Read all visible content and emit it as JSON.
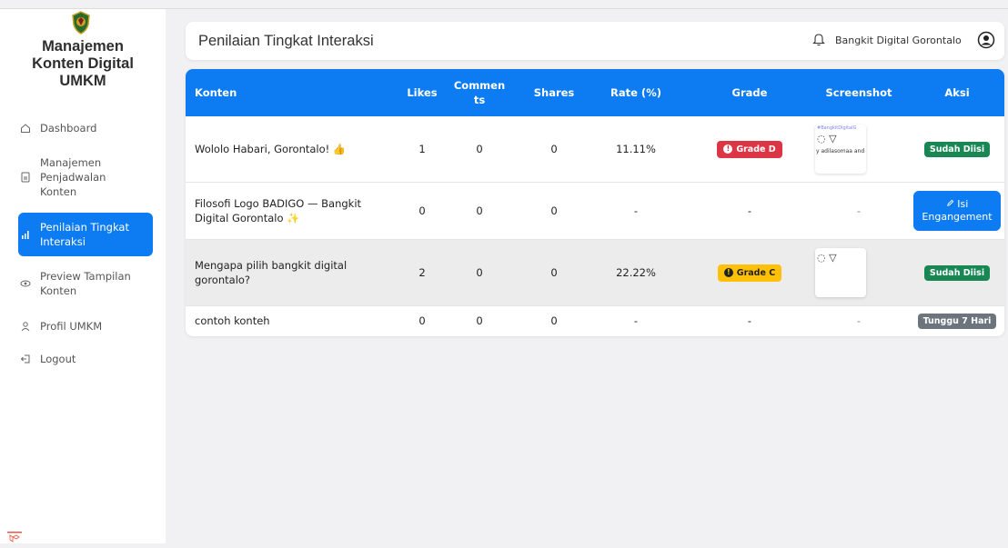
{
  "sidebar": {
    "brand_lines": [
      "Manajemen",
      "Konten Digital",
      "UMKM"
    ],
    "items": [
      {
        "label": "Dashboard",
        "icon": "home-icon"
      },
      {
        "label": "Manajemen Penjadwalan Konten",
        "icon": "file-icon"
      },
      {
        "label": "Penilaian Tingkat Interaksi",
        "icon": "bar-chart-icon",
        "active": true
      },
      {
        "label": "Preview Tampilan Konten",
        "icon": "eye-icon"
      },
      {
        "label": "Profil UMKM",
        "icon": "user-icon"
      },
      {
        "label": "Logout",
        "icon": "logout-icon"
      }
    ]
  },
  "header": {
    "title": "Penilaian Tingkat Interaksi",
    "user_name": "Bangkit Digital Gorontalo"
  },
  "table": {
    "columns": [
      "Konten",
      "Likes",
      "Commen\nts",
      "Shares",
      "Rate (%)",
      "Grade",
      "Screenshot",
      "Aksi"
    ],
    "rows": [
      {
        "konten": "Wololo Habari, Gorontalo! 👍",
        "likes": "1",
        "comments": "0",
        "shares": "0",
        "rate": "11.11%",
        "grade": "Grade D",
        "screenshot_tag": "#BangkitDigitalG",
        "screenshot_caption": "y adilasomaa and",
        "aksi": "Sudah Diisi"
      },
      {
        "konten": "Filosofi Logo BADIGO — Bangkit Digital Gorontalo ✨",
        "likes": "0",
        "comments": "0",
        "shares": "0",
        "rate": "-",
        "grade": "-",
        "screenshot": "-",
        "aksi_line1": "Isi",
        "aksi_line2": "Engangement"
      },
      {
        "konten": "Mengapa pilih bangkit digital gorontalo?",
        "likes": "2",
        "comments": "0",
        "shares": "0",
        "rate": "22.22%",
        "grade": "Grade C",
        "aksi": "Sudah Diisi"
      },
      {
        "konten": "contoh konteh",
        "likes": "0",
        "comments": "0",
        "shares": "0",
        "rate": "-",
        "grade": "-",
        "screenshot": "-",
        "aksi": "Tunggu 7 Hari"
      }
    ]
  },
  "colors": {
    "primary": "#0d7cf2",
    "grade_d": "#dc3545",
    "grade_c": "#ffc107",
    "success": "#198754",
    "muted": "#6c757d"
  }
}
